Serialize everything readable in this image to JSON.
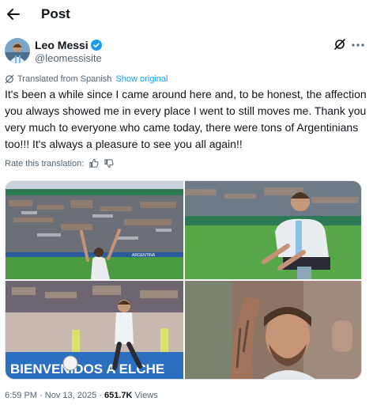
{
  "header": {
    "title": "Post"
  },
  "author": {
    "name": "Leo Messi",
    "handle": "@leomessisite"
  },
  "translation": {
    "notice": "Translated from Spanish",
    "show_original": "Show original",
    "rate_label": "Rate this translation:"
  },
  "tweet": {
    "text": "It's been a while since I came around here and, to be honest, the affection you always showed me in every place I went to still moves me. Thank you very much to everyone who came today, there were tons of Argentinians too!!! It's always a pleasure to see you all again!!"
  },
  "photos": {
    "banner_text": "BIENVENIDOS A ELCHE",
    "board_text": "ARGENTINA"
  },
  "meta": {
    "time": "6:59 PM",
    "date": "Nov 13, 2025",
    "dot": "·",
    "views_count": "651.7K",
    "views_label": "Views"
  },
  "colors": {
    "accent": "#1d9bf0",
    "secondary_text": "#536471",
    "pitch_green": "#3f8f3a",
    "banner_blue": "#2a6fc0"
  },
  "icons": [
    "back-arrow-icon",
    "verified-badge-icon",
    "grok-icon",
    "more-icon",
    "translate-icon",
    "thumbs-up-icon",
    "thumbs-down-icon"
  ]
}
